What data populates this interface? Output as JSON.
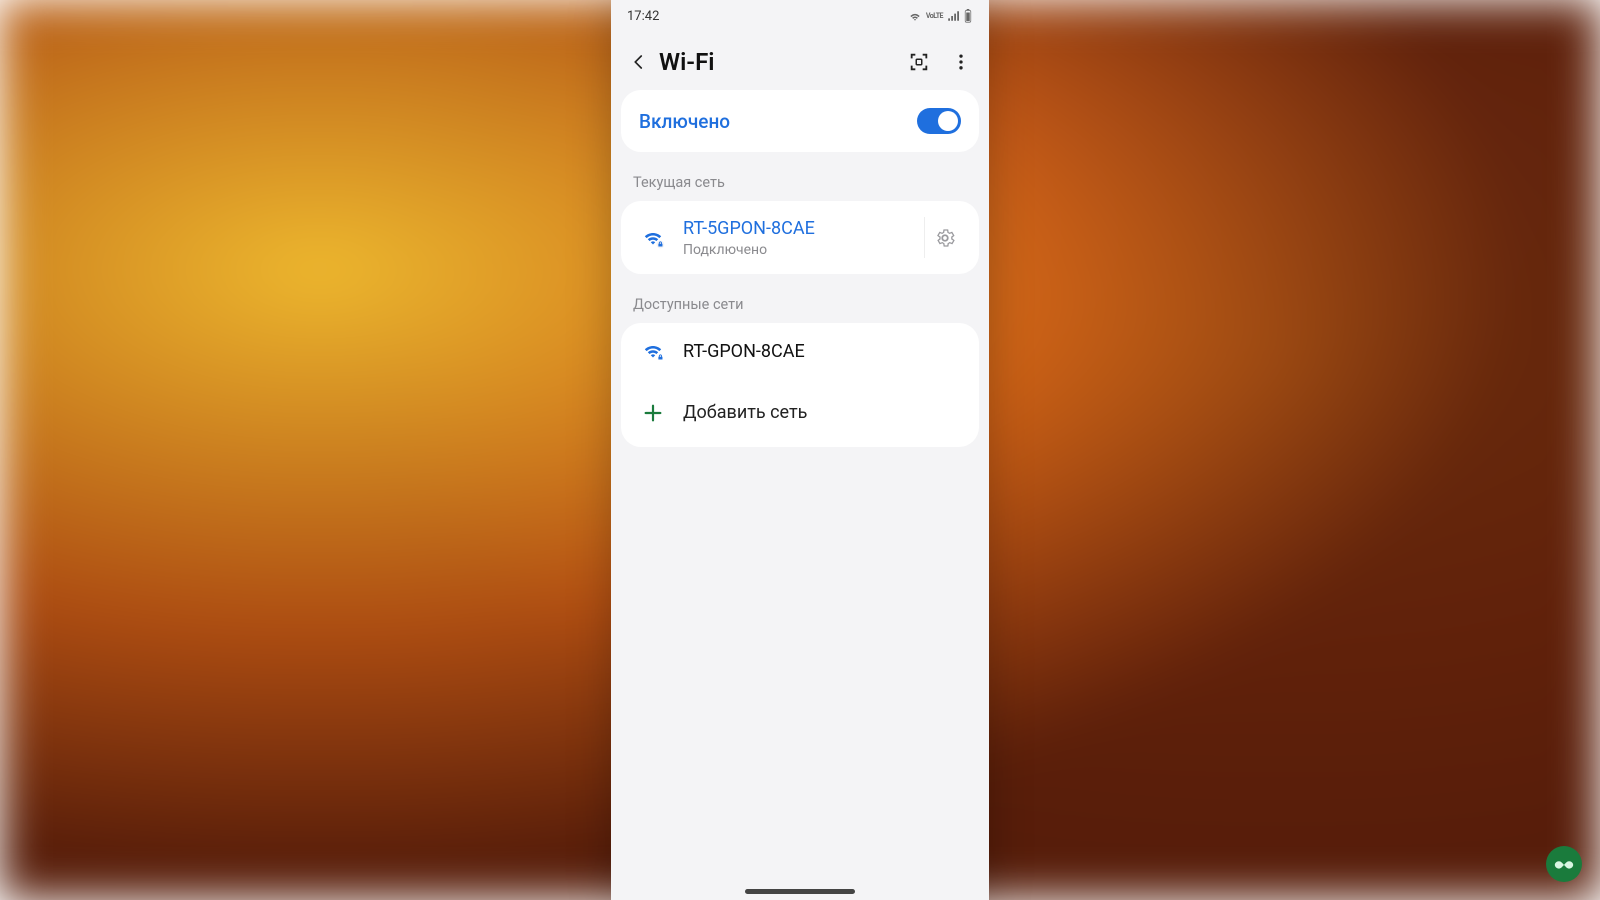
{
  "status_bar": {
    "time": "17:42"
  },
  "header": {
    "title": "Wi-Fi"
  },
  "wifi_toggle": {
    "label": "Включено",
    "enabled": true
  },
  "sections": {
    "current_label": "Текущая сеть",
    "available_label": "Доступные сети"
  },
  "current_network": {
    "ssid": "RT-5GPON-8CAE",
    "status": "Подключено"
  },
  "available_networks": [
    {
      "ssid": "RT-GPON-8CAE"
    }
  ],
  "add_network": {
    "label": "Добавить сеть"
  },
  "colors": {
    "accent": "#1f6fde",
    "add_green": "#1a7b3c"
  }
}
